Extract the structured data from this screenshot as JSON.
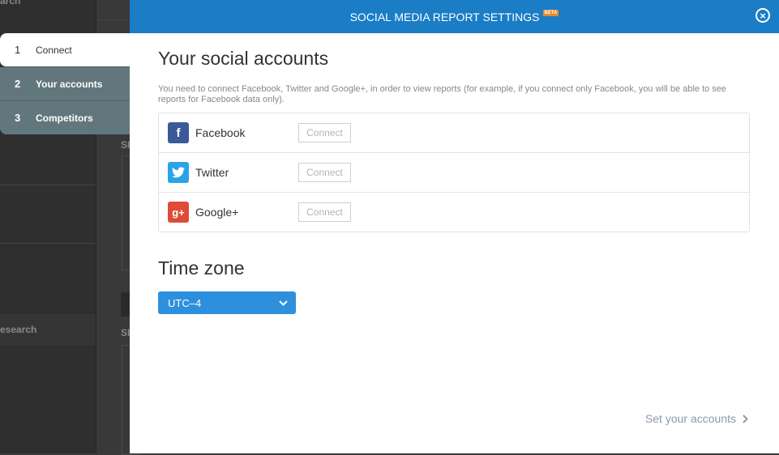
{
  "background": {
    "top_label": "arch",
    "section_label": "esearch",
    "marker1": "SI",
    "marker2": "SI"
  },
  "steps": [
    {
      "num": "1",
      "label": "Connect"
    },
    {
      "num": "2",
      "label": "Your accounts"
    },
    {
      "num": "3",
      "label": "Competitors"
    }
  ],
  "modal": {
    "title": "SOCIAL MEDIA REPORT SETTINGS",
    "beta": "BETA",
    "close_icon": "×"
  },
  "social": {
    "heading": "Your social accounts",
    "description": "You need to connect Facebook, Twitter and Google+, in order to view reports (for example, if you connect only Facebook, you will be able to see reports for Facebook data only).",
    "accounts": [
      {
        "name": "Facebook",
        "icon": "facebook-icon",
        "glyph": "f",
        "color": "#3b5998",
        "button": "Connect"
      },
      {
        "name": "Twitter",
        "icon": "twitter-icon",
        "glyph": "t",
        "color": "#2aa3e8",
        "button": "Connect"
      },
      {
        "name": "Google+",
        "icon": "google-plus-icon",
        "glyph": "g+",
        "color": "#dd4b39",
        "button": "Connect"
      }
    ]
  },
  "timezone": {
    "heading": "Time zone",
    "selected": "UTC–4"
  },
  "footer": {
    "link": "Set your accounts"
  }
}
